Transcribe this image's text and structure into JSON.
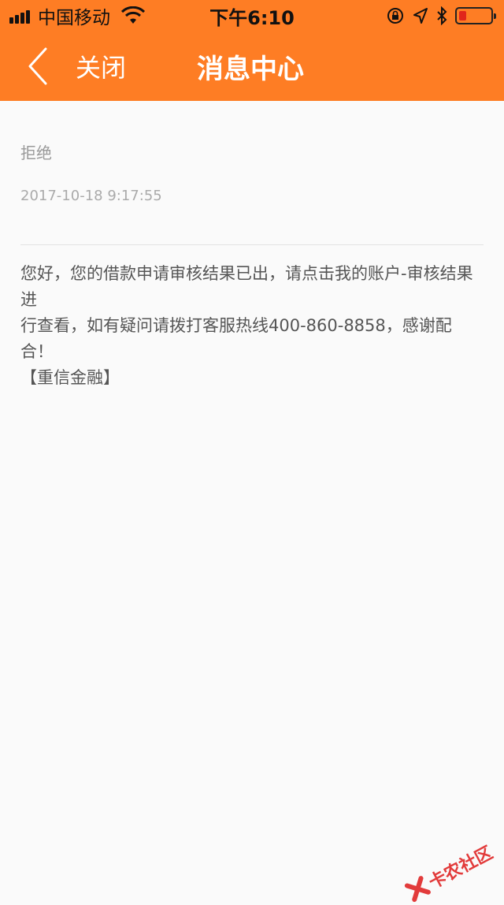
{
  "status_bar": {
    "carrier": "中国移动",
    "time": "下午6:10",
    "icons": [
      "signal-icon",
      "wifi-icon",
      "orientation-lock-icon",
      "location-icon",
      "bluetooth-icon",
      "battery-icon"
    ],
    "battery_color": "#e0261b"
  },
  "nav": {
    "close_label": "关闭",
    "title": "消息中心",
    "background": "#fe7d24"
  },
  "message": {
    "title": "拒绝",
    "timestamp": "2017-10-18 9:17:55",
    "body_line1": "您好，您的借款申请审核结果已出，请点击我的账户-审核结果进",
    "body_line2": "行查看，如有疑问请拨打客服热线400-860-8858，感谢配合！",
    "body_line3": "【重信金融】"
  },
  "watermark": {
    "text": "卡农社区",
    "color": "#e23b3b"
  }
}
